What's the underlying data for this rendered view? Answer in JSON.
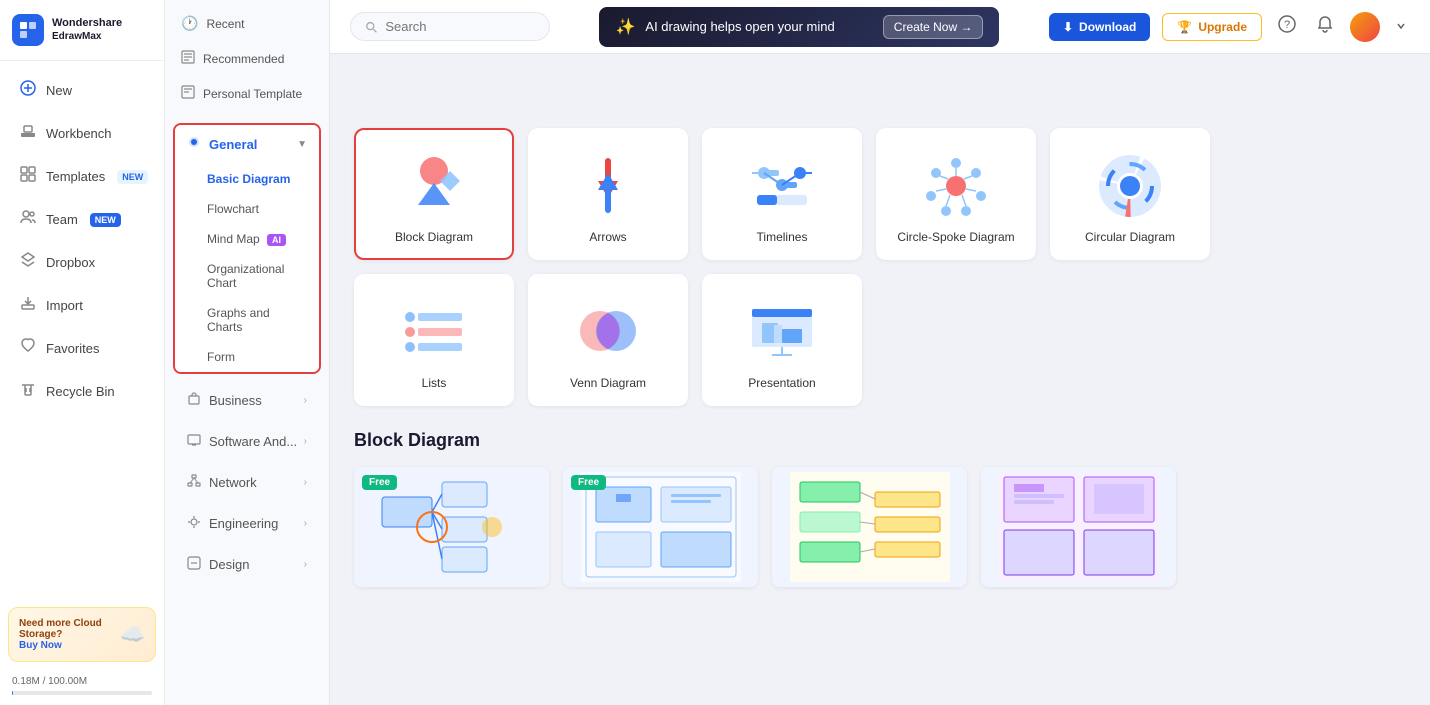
{
  "app": {
    "brand": "Wondershare",
    "sub": "EdrawMax",
    "logo_letter": "E"
  },
  "left_nav": {
    "items": [
      {
        "id": "new",
        "label": "New",
        "icon": "➕",
        "badge": null
      },
      {
        "id": "workbench",
        "label": "Workbench",
        "icon": "🔧",
        "badge": null
      },
      {
        "id": "templates",
        "label": "Templates",
        "icon": "📄",
        "badge": "NEW"
      },
      {
        "id": "team",
        "label": "Team",
        "icon": "👥",
        "badge": "NEW"
      },
      {
        "id": "dropbox",
        "label": "Dropbox",
        "icon": "📦",
        "badge": null
      },
      {
        "id": "import",
        "label": "Import",
        "icon": "📥",
        "badge": null
      },
      {
        "id": "favorites",
        "label": "Favorites",
        "icon": "❤️",
        "badge": null
      },
      {
        "id": "recycle",
        "label": "Recycle Bin",
        "icon": "🗑️",
        "badge": null
      }
    ],
    "cloud": {
      "title": "Need more Cloud Storage?",
      "buy": "Buy Now"
    },
    "storage": {
      "label": "0.18M / 100.00M",
      "percent": 0.18
    }
  },
  "middle_nav": {
    "top_items": [
      {
        "id": "recent",
        "label": "Recent",
        "icon": "🕐"
      },
      {
        "id": "recommended",
        "label": "Recommended",
        "icon": "📋"
      },
      {
        "id": "personal",
        "label": "Personal Template",
        "icon": "📄"
      }
    ],
    "general": {
      "label": "General",
      "icon": "🔷",
      "expanded": true,
      "sub_items": [
        {
          "id": "basic",
          "label": "Basic Diagram",
          "active": true
        },
        {
          "id": "flowchart",
          "label": "Flowchart"
        },
        {
          "id": "mindmap",
          "label": "Mind Map",
          "badge": "AI"
        },
        {
          "id": "orgchart",
          "label": "Organizational Chart"
        },
        {
          "id": "graphs",
          "label": "Graphs and Charts"
        },
        {
          "id": "form",
          "label": "Form"
        }
      ]
    },
    "categories": [
      {
        "id": "business",
        "label": "Business",
        "icon": "💼"
      },
      {
        "id": "software",
        "label": "Software And...",
        "icon": "💻"
      },
      {
        "id": "network",
        "label": "Network",
        "icon": "🌐"
      },
      {
        "id": "engineering",
        "label": "Engineering",
        "icon": "⚙️"
      },
      {
        "id": "design",
        "label": "Design",
        "icon": "🎨"
      }
    ]
  },
  "topbar": {
    "search_placeholder": "Search",
    "ai_banner": {
      "text": "AI drawing helps open your mind",
      "cta": "Create Now →"
    },
    "download_label": "Download",
    "upgrade_label": "Upgrade"
  },
  "main": {
    "featured_section_title": "",
    "template_cards": [
      {
        "id": "block",
        "label": "Block Diagram",
        "selected": true
      },
      {
        "id": "arrows",
        "label": "Arrows"
      },
      {
        "id": "timelines",
        "label": "Timelines"
      },
      {
        "id": "circlespoke",
        "label": "Circle-Spoke Diagram"
      },
      {
        "id": "circular",
        "label": "Circular Diagram"
      },
      {
        "id": "lists",
        "label": "Lists"
      },
      {
        "id": "venn",
        "label": "Venn Diagram"
      },
      {
        "id": "presentation",
        "label": "Presentation"
      }
    ],
    "block_diagram_section": {
      "title": "Block Diagram",
      "previews": [
        {
          "id": "p1",
          "free": true
        },
        {
          "id": "p2",
          "free": true
        },
        {
          "id": "p3",
          "free": false
        },
        {
          "id": "p4",
          "free": false
        }
      ]
    }
  }
}
